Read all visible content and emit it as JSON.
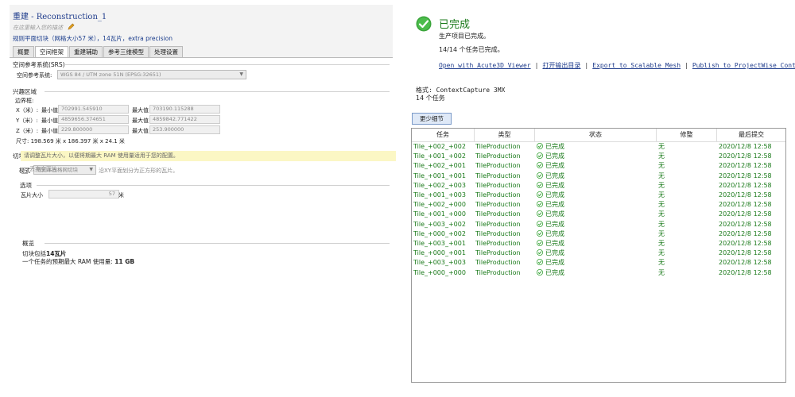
{
  "left": {
    "title": "重建 - Reconstruction_1",
    "subtitle": "在这里输入您的描述",
    "description": "规则平面切块（网格大小57 米），14瓦片，extra precision",
    "tabs": [
      "概要",
      "空间框架",
      "重建辅助",
      "参考三维模型",
      "处理设置"
    ],
    "active_tab": 1,
    "srs": {
      "section": "空间参考系统(SRS)",
      "label": "空间参考系统:",
      "value": "WGS 84 / UTM zone 51N (EPSG:32651)"
    },
    "roi": {
      "section": "兴趣区域",
      "bbox_label": "边界框:",
      "min_label": "最小值",
      "max_label": "最大值",
      "rows": [
        {
          "axis": "X（米）:",
          "min": "702991.545910",
          "max": "703190.115288"
        },
        {
          "axis": "Y（米）:",
          "min": "4859656.374651",
          "max": "4859842.771422"
        },
        {
          "axis": "Z（米）:",
          "min": "229.800000",
          "max": "253.900000"
        }
      ],
      "size": "尺寸: 198.569 米 x 186.397 米 x 24.1 米"
    },
    "tiling": {
      "section": "切块",
      "mode_label": "模式",
      "mode_value": "规则平面格网切块",
      "mode_hint": "沿XY平面划分为正方形的瓦片。",
      "options_section": "选项",
      "tile_size_label": "瓦片大小",
      "tile_size_value": "57",
      "tile_size_unit": "米",
      "warning": "请调整瓦片大小，以便将期最大 RAM 使用量适用于您的配置。",
      "discard_empty": "丢弃空瓦片"
    },
    "overview": {
      "section": "概览",
      "line1_prefix": "切块包括",
      "line1_value": "14瓦片",
      "line2_prefix": "一个任务的预期最大 RAM 使用量:",
      "line2_value": "11 GB"
    }
  },
  "right": {
    "status_title": "已完成",
    "line1": "生产项目已完成。",
    "line2": "14/14 个任务已完成。",
    "links": [
      "Open with Acute3D Viewer",
      "打开输出目录",
      "Export to Scalable Mesh",
      "Publish to ProjectWise Context"
    ],
    "format": "格式: ContextCapture 3MX",
    "task_count": "14 个任务",
    "less_details": "更少细节",
    "table": {
      "columns": [
        "任务",
        "类型",
        "状态",
        "修整",
        "最后提交"
      ],
      "rows": [
        [
          "Tile_+002_+002",
          "TileProduction",
          "已完成",
          "无",
          "2020/12/8 12:58"
        ],
        [
          "Tile_+001_+002",
          "TileProduction",
          "已完成",
          "无",
          "2020/12/8 12:58"
        ],
        [
          "Tile_+002_+001",
          "TileProduction",
          "已完成",
          "无",
          "2020/12/8 12:58"
        ],
        [
          "Tile_+001_+001",
          "TileProduction",
          "已完成",
          "无",
          "2020/12/8 12:58"
        ],
        [
          "Tile_+002_+003",
          "TileProduction",
          "已完成",
          "无",
          "2020/12/8 12:58"
        ],
        [
          "Tile_+001_+003",
          "TileProduction",
          "已完成",
          "无",
          "2020/12/8 12:58"
        ],
        [
          "Tile_+002_+000",
          "TileProduction",
          "已完成",
          "无",
          "2020/12/8 12:58"
        ],
        [
          "Tile_+001_+000",
          "TileProduction",
          "已完成",
          "无",
          "2020/12/8 12:58"
        ],
        [
          "Tile_+003_+002",
          "TileProduction",
          "已完成",
          "无",
          "2020/12/8 12:58"
        ],
        [
          "Tile_+000_+002",
          "TileProduction",
          "已完成",
          "无",
          "2020/12/8 12:58"
        ],
        [
          "Tile_+003_+001",
          "TileProduction",
          "已完成",
          "无",
          "2020/12/8 12:58"
        ],
        [
          "Tile_+000_+001",
          "TileProduction",
          "已完成",
          "无",
          "2020/12/8 12:58"
        ],
        [
          "Tile_+003_+003",
          "TileProduction",
          "已完成",
          "无",
          "2020/12/8 12:58"
        ],
        [
          "Tile_+000_+000",
          "TileProduction",
          "已完成",
          "无",
          "2020/12/8 12:58"
        ]
      ]
    }
  },
  "colors": {
    "title_blue": "#1f3c8c",
    "done_green": "#1a7a1a",
    "warning_bg": "#fbf7c4"
  }
}
